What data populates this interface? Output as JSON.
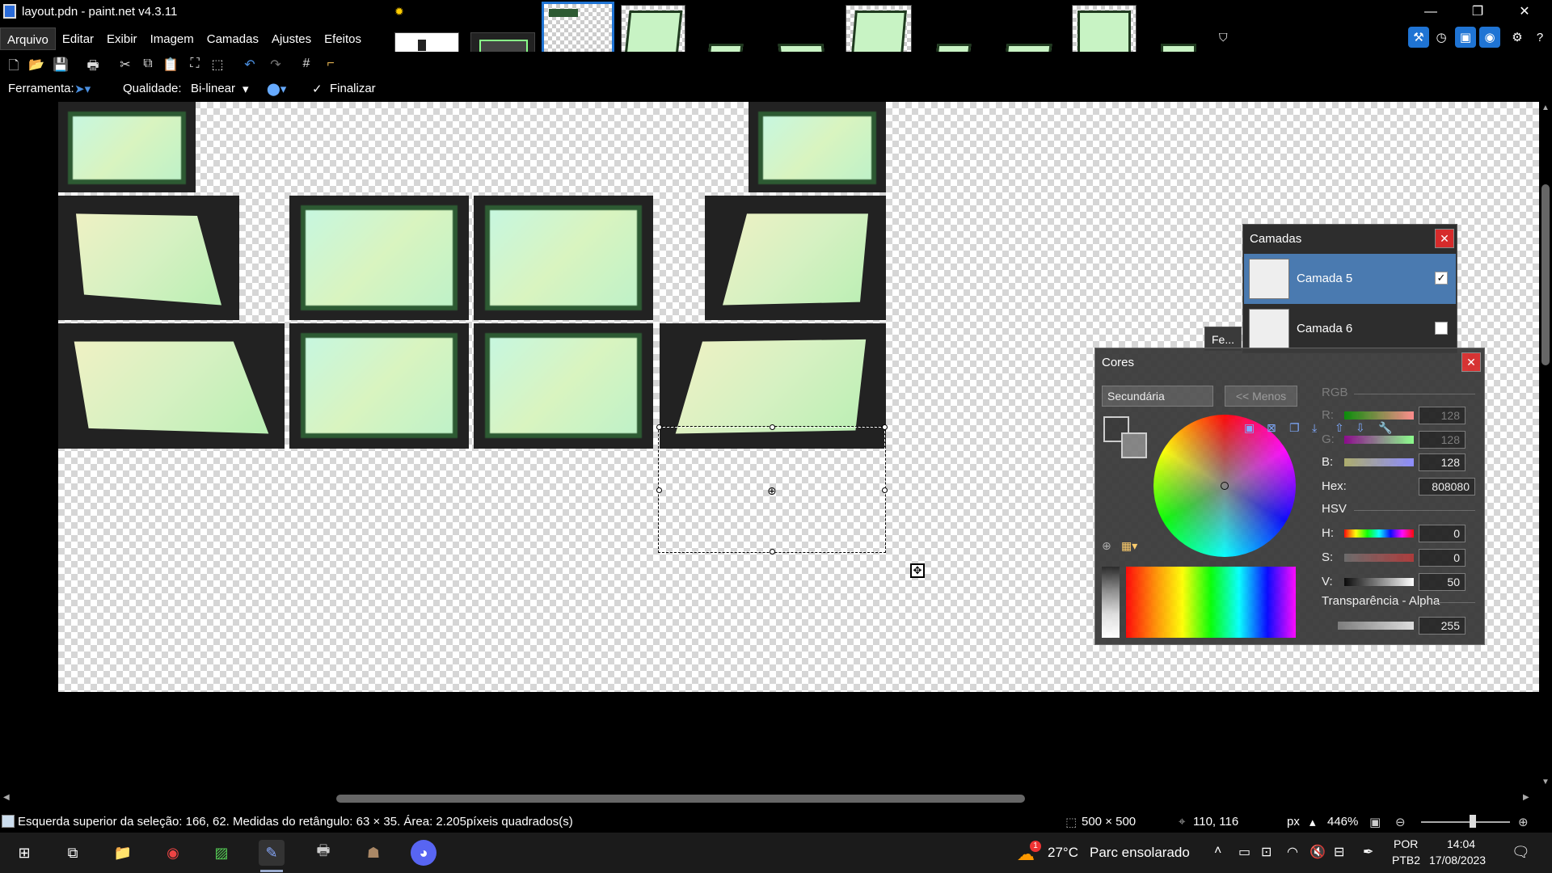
{
  "window": {
    "title": "layout.pdn - paint.net v4.3.11",
    "controls": {
      "minimize": "—",
      "restore": "❐",
      "close": "✕"
    }
  },
  "menu": [
    "Arquivo",
    "Editar",
    "Exibir",
    "Imagem",
    "Camadas",
    "Ajustes",
    "Efeitos"
  ],
  "toolbar2": {
    "tool_label": "Ferramenta:",
    "quality_label": "Qualidade:",
    "quality_value": "Bi-linear",
    "finish_label": "Finalizar"
  },
  "layers_panel": {
    "title": "Camadas",
    "layers": [
      {
        "name": "Camada 5",
        "visible": true,
        "selected": true
      },
      {
        "name": "Camada 6",
        "visible": false,
        "selected": false
      }
    ]
  },
  "tools_peek": {
    "label": "Fe..."
  },
  "colors_panel": {
    "title": "Cores",
    "selector": "Secundária",
    "less_button": "<< Menos",
    "rgb_label": "RGB",
    "r_label": "R:",
    "g_label": "G:",
    "b_label": "B:",
    "r": "128",
    "g": "128",
    "b": "128",
    "hex_label": "Hex:",
    "hex": "808080",
    "hsv_label": "HSV",
    "h_label": "H:",
    "s_label": "S:",
    "v_label": "V:",
    "h": "0",
    "s": "0",
    "v": "50",
    "alpha_label": "Transparência - Alpha",
    "alpha": "255"
  },
  "statusbar": {
    "selection_info": "Esquerda superior da seleção: 166, 62. Medidas do retângulo:  63 × 35. Área: 2.205píxeis quadrados(s)",
    "image_size": "500 × 500",
    "cursor_pos": "110, 116",
    "unit": "px",
    "zoom": "446%"
  },
  "taskbar": {
    "weather_temp": "27°C",
    "weather_desc": "Parc ensolarado",
    "weather_badge": "1",
    "lang1": "POR",
    "lang2": "PTB2",
    "time": "14:04",
    "date": "17/08/2023"
  },
  "colors": {
    "accent": "#1f74d4",
    "layer_selected": "#4a7ab0",
    "close_red": "#d62b2b"
  }
}
